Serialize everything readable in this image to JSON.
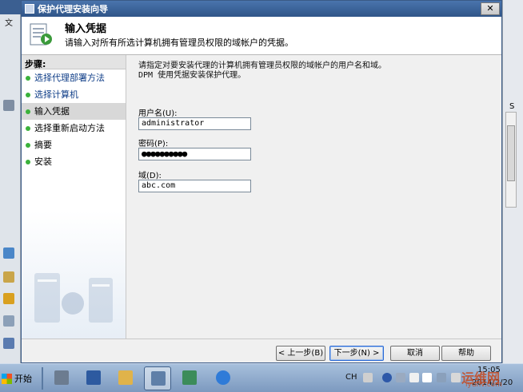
{
  "window": {
    "title": "保护代理安装向导",
    "close_label": "✕"
  },
  "header": {
    "title": "输入凭据",
    "subtitle": "请输入对所有所选计算机拥有管理员权限的域帐户的凭据。"
  },
  "steps": {
    "heading": "步骤:",
    "items": [
      {
        "label": "选择代理部署方法",
        "state": "done"
      },
      {
        "label": "选择计算机",
        "state": "done"
      },
      {
        "label": "输入凭据",
        "state": "current"
      },
      {
        "label": "选择重新启动方法",
        "state": "pending"
      },
      {
        "label": "摘要",
        "state": "pending"
      },
      {
        "label": "安装",
        "state": "pending"
      }
    ]
  },
  "main": {
    "instruction_line1": "请指定对要安装代理的计算机拥有管理员权限的域帐户的用户名和域。",
    "instruction_line2": "DPM 使用凭据安装保护代理。",
    "username_label": "用户名(U):",
    "username_value": "administrator",
    "password_label": "密码(P):",
    "password_value": "●●●●●●●●●●",
    "domain_label": "域(D):",
    "domain_value": "abc.com"
  },
  "buttons": {
    "back": "< 上一步(B)",
    "next": "下一步(N) >",
    "cancel": "取消",
    "help": "帮助"
  },
  "background": {
    "left_menu_text": "文",
    "right_text": "S"
  },
  "taskbar": {
    "start_label": "开始",
    "language": "CH",
    "time": "15:05",
    "date": "2014/2/20"
  },
  "watermark": {
    "line1": "运维网",
    "line2": "iyunv.com"
  },
  "colors": {
    "title_bar": "#2f5588",
    "step_dot": "#3bb23b",
    "link_blue": "#0d3c87",
    "taskbar": "#7c99bf"
  }
}
